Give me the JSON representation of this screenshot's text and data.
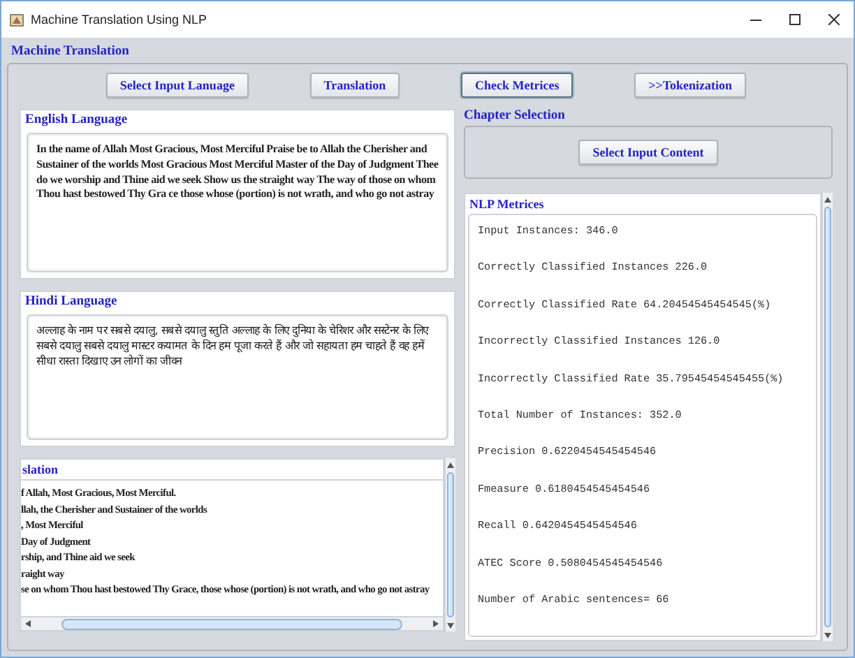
{
  "window": {
    "title": "Machine Translation Using NLP"
  },
  "main_panel": {
    "title": "Machine Translation"
  },
  "buttons": [
    {
      "label": "Select Input Lanuage",
      "focused": false
    },
    {
      "label": "Translation",
      "focused": false
    },
    {
      "label": "Check Metrices",
      "focused": true
    },
    {
      "label": ">>Tokenization",
      "focused": false
    }
  ],
  "english": {
    "title": "English Language",
    "text": "In the name of Allah Most Gracious, Most Merciful Praise be to Allah the Cherisher and Sustainer of the worlds Most Gracious Most Merciful Master of the Day of Judgment Thee do we worship and Thine aid we seek Show us the straight way The way of those on whom Thou hast bestowed Thy Gra ce those whose (portion) is not wrath, and who go not astray"
  },
  "hindi": {
    "title": "Hindi Language",
    "text": "अल्लाह के नाम पर सबसे दयालु, सबसे दयालु स्तुति अल्लाह के लिए दुनिया के चेरिशर और सस्टेनर के लिए सबसे दयालु सबसे दयालु मास्टर कयामत के दिन हम पूजा करते हैं और जो सहायता हम चाहते हैं वह हमें सीधा रास्ता दिखाए उन लोगों का जीवन"
  },
  "translation": {
    "title": "slation",
    "lines": [
      "f Allah, Most Gracious, Most Merciful.",
      "llah, the Cherisher and Sustainer of the worlds",
      ", Most Merciful",
      "Day of Judgment",
      "rship, and Thine aid we seek",
      "raight way",
      "se on whom Thou hast bestowed Thy Grace, those whose (portion) is not wrath, and who go not astray"
    ]
  },
  "chapter_selection": {
    "title": "Chapter Selection",
    "button": "Select Input Content"
  },
  "nlp_metrics": {
    "title": "NLP Metrices",
    "lines": [
      "Input Instances: 346.0",
      "Correctly Classified Instances 226.0",
      "Correctly Classified Rate 64.20454545454545(%)",
      "Incorrectly Classified Instances 126.0",
      "Incorrectly Classified Rate 35.79545454545455(%)",
      "Total Number of Instances: 352.0",
      "Precision 0.6220454545454546",
      "Fmeasure 0.6180454545454546",
      "Recall 0.6420454545454546",
      "ATEC Score 0.5080454545454546",
      "Number of Arabic sentences= 66"
    ]
  }
}
